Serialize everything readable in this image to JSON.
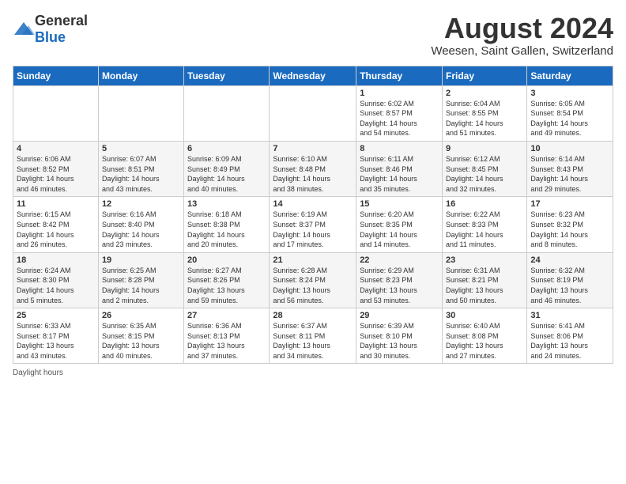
{
  "header": {
    "logo_general": "General",
    "logo_blue": "Blue",
    "title": "August 2024",
    "subtitle": "Weesen, Saint Gallen, Switzerland"
  },
  "weekdays": [
    "Sunday",
    "Monday",
    "Tuesday",
    "Wednesday",
    "Thursday",
    "Friday",
    "Saturday"
  ],
  "weeks": [
    [
      {
        "day": "",
        "info": ""
      },
      {
        "day": "",
        "info": ""
      },
      {
        "day": "",
        "info": ""
      },
      {
        "day": "",
        "info": ""
      },
      {
        "day": "1",
        "info": "Sunrise: 6:02 AM\nSunset: 8:57 PM\nDaylight: 14 hours\nand 54 minutes."
      },
      {
        "day": "2",
        "info": "Sunrise: 6:04 AM\nSunset: 8:55 PM\nDaylight: 14 hours\nand 51 minutes."
      },
      {
        "day": "3",
        "info": "Sunrise: 6:05 AM\nSunset: 8:54 PM\nDaylight: 14 hours\nand 49 minutes."
      }
    ],
    [
      {
        "day": "4",
        "info": "Sunrise: 6:06 AM\nSunset: 8:52 PM\nDaylight: 14 hours\nand 46 minutes."
      },
      {
        "day": "5",
        "info": "Sunrise: 6:07 AM\nSunset: 8:51 PM\nDaylight: 14 hours\nand 43 minutes."
      },
      {
        "day": "6",
        "info": "Sunrise: 6:09 AM\nSunset: 8:49 PM\nDaylight: 14 hours\nand 40 minutes."
      },
      {
        "day": "7",
        "info": "Sunrise: 6:10 AM\nSunset: 8:48 PM\nDaylight: 14 hours\nand 38 minutes."
      },
      {
        "day": "8",
        "info": "Sunrise: 6:11 AM\nSunset: 8:46 PM\nDaylight: 14 hours\nand 35 minutes."
      },
      {
        "day": "9",
        "info": "Sunrise: 6:12 AM\nSunset: 8:45 PM\nDaylight: 14 hours\nand 32 minutes."
      },
      {
        "day": "10",
        "info": "Sunrise: 6:14 AM\nSunset: 8:43 PM\nDaylight: 14 hours\nand 29 minutes."
      }
    ],
    [
      {
        "day": "11",
        "info": "Sunrise: 6:15 AM\nSunset: 8:42 PM\nDaylight: 14 hours\nand 26 minutes."
      },
      {
        "day": "12",
        "info": "Sunrise: 6:16 AM\nSunset: 8:40 PM\nDaylight: 14 hours\nand 23 minutes."
      },
      {
        "day": "13",
        "info": "Sunrise: 6:18 AM\nSunset: 8:38 PM\nDaylight: 14 hours\nand 20 minutes."
      },
      {
        "day": "14",
        "info": "Sunrise: 6:19 AM\nSunset: 8:37 PM\nDaylight: 14 hours\nand 17 minutes."
      },
      {
        "day": "15",
        "info": "Sunrise: 6:20 AM\nSunset: 8:35 PM\nDaylight: 14 hours\nand 14 minutes."
      },
      {
        "day": "16",
        "info": "Sunrise: 6:22 AM\nSunset: 8:33 PM\nDaylight: 14 hours\nand 11 minutes."
      },
      {
        "day": "17",
        "info": "Sunrise: 6:23 AM\nSunset: 8:32 PM\nDaylight: 14 hours\nand 8 minutes."
      }
    ],
    [
      {
        "day": "18",
        "info": "Sunrise: 6:24 AM\nSunset: 8:30 PM\nDaylight: 14 hours\nand 5 minutes."
      },
      {
        "day": "19",
        "info": "Sunrise: 6:25 AM\nSunset: 8:28 PM\nDaylight: 14 hours\nand 2 minutes."
      },
      {
        "day": "20",
        "info": "Sunrise: 6:27 AM\nSunset: 8:26 PM\nDaylight: 13 hours\nand 59 minutes."
      },
      {
        "day": "21",
        "info": "Sunrise: 6:28 AM\nSunset: 8:24 PM\nDaylight: 13 hours\nand 56 minutes."
      },
      {
        "day": "22",
        "info": "Sunrise: 6:29 AM\nSunset: 8:23 PM\nDaylight: 13 hours\nand 53 minutes."
      },
      {
        "day": "23",
        "info": "Sunrise: 6:31 AM\nSunset: 8:21 PM\nDaylight: 13 hours\nand 50 minutes."
      },
      {
        "day": "24",
        "info": "Sunrise: 6:32 AM\nSunset: 8:19 PM\nDaylight: 13 hours\nand 46 minutes."
      }
    ],
    [
      {
        "day": "25",
        "info": "Sunrise: 6:33 AM\nSunset: 8:17 PM\nDaylight: 13 hours\nand 43 minutes."
      },
      {
        "day": "26",
        "info": "Sunrise: 6:35 AM\nSunset: 8:15 PM\nDaylight: 13 hours\nand 40 minutes."
      },
      {
        "day": "27",
        "info": "Sunrise: 6:36 AM\nSunset: 8:13 PM\nDaylight: 13 hours\nand 37 minutes."
      },
      {
        "day": "28",
        "info": "Sunrise: 6:37 AM\nSunset: 8:11 PM\nDaylight: 13 hours\nand 34 minutes."
      },
      {
        "day": "29",
        "info": "Sunrise: 6:39 AM\nSunset: 8:10 PM\nDaylight: 13 hours\nand 30 minutes."
      },
      {
        "day": "30",
        "info": "Sunrise: 6:40 AM\nSunset: 8:08 PM\nDaylight: 13 hours\nand 27 minutes."
      },
      {
        "day": "31",
        "info": "Sunrise: 6:41 AM\nSunset: 8:06 PM\nDaylight: 13 hours\nand 24 minutes."
      }
    ]
  ],
  "footer": "Daylight hours"
}
